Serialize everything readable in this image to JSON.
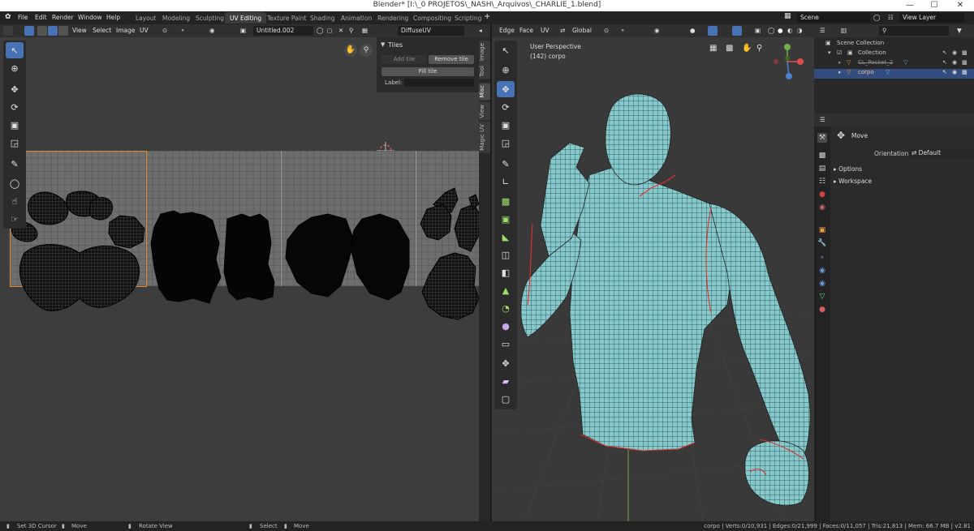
{
  "window": {
    "title": "Blender* [I:\\_0 PROJETOS\\_NASH\\_Arquivos\\_CHARLIE_1.blend]"
  },
  "menu": [
    "File",
    "Edit",
    "Render",
    "Window",
    "Help"
  ],
  "workspaces": [
    {
      "label": "Layout",
      "active": false
    },
    {
      "label": "Modeling",
      "active": false
    },
    {
      "label": "Sculpting",
      "active": false
    },
    {
      "label": "UV Editing",
      "active": true
    },
    {
      "label": "Texture Paint",
      "active": false
    },
    {
      "label": "Shading",
      "active": false
    },
    {
      "label": "Animation",
      "active": false
    },
    {
      "label": "Rendering",
      "active": false
    },
    {
      "label": "Compositing",
      "active": false
    },
    {
      "label": "Scripting",
      "active": false
    }
  ],
  "scene": "Scene",
  "view_layer": "View Layer",
  "uv_editor": {
    "menus": [
      "View",
      "Select",
      "Image",
      "UV"
    ],
    "image_name": "Untitled.002",
    "uv_map": "DiffuseUV",
    "tiles_panel": {
      "title": "Tiles",
      "add_tile": "Add tile",
      "remove_tile": "Remove tile",
      "fill_tile": "Fill tile",
      "label_field": "Label:"
    },
    "side_tabs": [
      "Image",
      "Tool",
      "Misc",
      "View",
      "Magic UV"
    ]
  },
  "viewport": {
    "mode_menus": [
      "Edge",
      "Face",
      "UV"
    ],
    "orientation": "Global",
    "view_name": "User Perspective",
    "object_info": "(142) corpo"
  },
  "outliner": {
    "rows": [
      {
        "label": "Scene Collection",
        "indent": 0
      },
      {
        "label": "Collection",
        "indent": 1
      },
      {
        "label": "CL_Pocket_2",
        "indent": 2
      },
      {
        "label": "corpo",
        "indent": 2,
        "selected": true
      }
    ]
  },
  "properties": {
    "tool_name": "Move",
    "orientation_label": "Orientation",
    "orientation_value": "Default",
    "sections": [
      "Options",
      "Workspace"
    ]
  },
  "status": {
    "left": [
      {
        "label": "Set 3D Cursor"
      },
      {
        "label": "Move"
      },
      {
        "label": "Rotate View"
      },
      {
        "label": "Select"
      },
      {
        "label": "Move"
      }
    ],
    "stats": "corpo | Verts:0/10,931 | Edges:0/21,999 | Faces:0/11,057 | Tris:21,813 | Mem: 66.7 MB | v2.81"
  },
  "colors": {
    "accent": "#4772b3",
    "active_tile": "#e88b2e",
    "mesh": "#86c9cc",
    "seam": "#e03030"
  }
}
